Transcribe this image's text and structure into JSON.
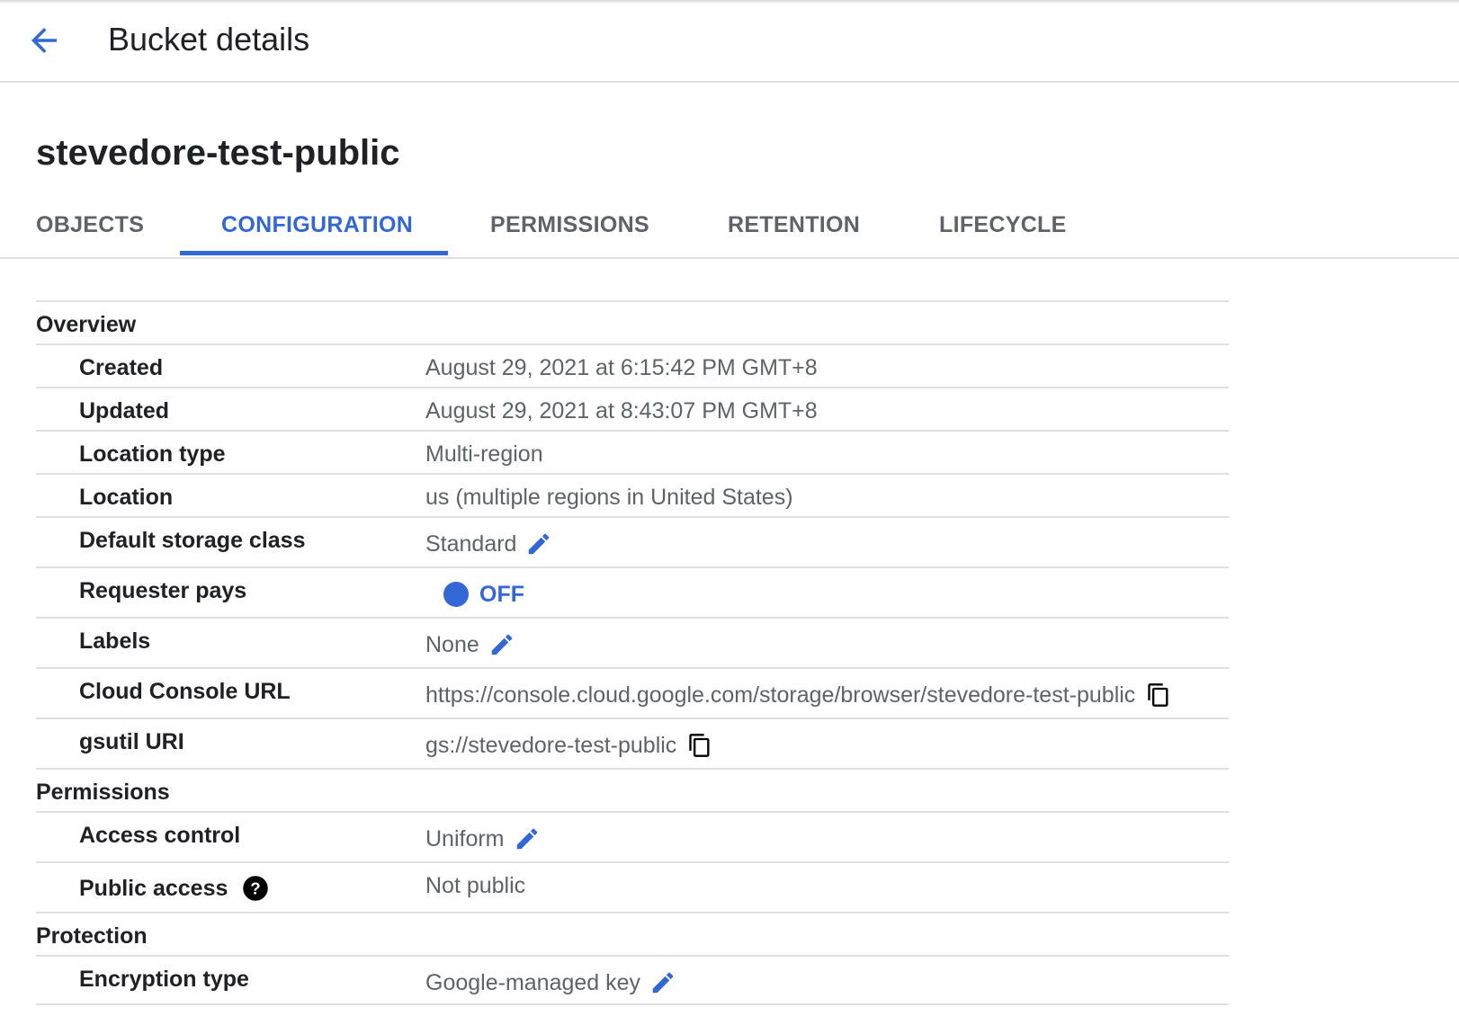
{
  "header": {
    "title": "Bucket details"
  },
  "bucket": {
    "name": "stevedore-test-public"
  },
  "tabs": [
    {
      "label": "OBJECTS"
    },
    {
      "label": "CONFIGURATION"
    },
    {
      "label": "PERMISSIONS"
    },
    {
      "label": "RETENTION"
    },
    {
      "label": "LIFECYCLE"
    }
  ],
  "active_tab": "CONFIGURATION",
  "colors": {
    "accent": "#3367d6",
    "text": "#202124",
    "muted": "#5f6368",
    "divider": "#e0e0e0"
  },
  "overview": {
    "title": "Overview",
    "created": {
      "label": "Created",
      "value": "August 29, 2021 at 6:15:42 PM GMT+8"
    },
    "updated": {
      "label": "Updated",
      "value": "August 29, 2021 at 8:43:07 PM GMT+8"
    },
    "location_type": {
      "label": "Location type",
      "value": "Multi-region"
    },
    "location": {
      "label": "Location",
      "value": "us (multiple regions in United States)"
    },
    "storage_class": {
      "label": "Default storage class",
      "value": "Standard",
      "icon": "edit-icon"
    },
    "requester_pays": {
      "label": "Requester pays",
      "value": "OFF"
    },
    "labels": {
      "label": "Labels",
      "value": "None",
      "icon": "edit-icon"
    },
    "console_url": {
      "label": "Cloud Console URL",
      "value": "https://console.cloud.google.com/storage/browser/stevedore-test-public",
      "icon": "copy-icon"
    },
    "gsutil_uri": {
      "label": "gsutil URI",
      "value": "gs://stevedore-test-public",
      "icon": "copy-icon"
    }
  },
  "permissions": {
    "title": "Permissions",
    "access_control": {
      "label": "Access control",
      "value": "Uniform",
      "icon": "edit-icon"
    },
    "public_access": {
      "label": "Public access",
      "value": "Not public",
      "icon": "help-icon"
    }
  },
  "protection": {
    "title": "Protection",
    "encryption": {
      "label": "Encryption type",
      "value": "Google-managed key",
      "icon": "edit-icon"
    }
  }
}
